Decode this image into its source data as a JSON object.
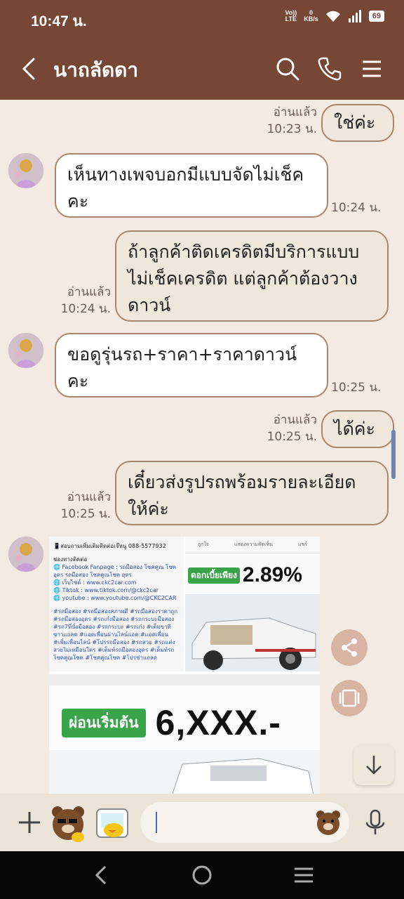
{
  "status": {
    "time": "10:47 น.",
    "net_top": "Vo))",
    "net_bottom": "LTE",
    "speed_top": "0",
    "speed_bottom": "KB/s",
    "battery": "69"
  },
  "header": {
    "title": "นาถลัดดา"
  },
  "messages": [
    {
      "text": "ใช่ค่ะ",
      "read": "อ่านแล้ว",
      "time": "10:23 น."
    },
    {
      "text": "เห็นทางเพจบอกมีแบบจัดไม่เช็คคะ",
      "time": "10:24 น."
    },
    {
      "text": "ถ้าลูกค้าติดเครดิตมีบริการแบบไม่เช็คเครดิต แต่ลูกค้าต้องวางดาวน์",
      "read": "อ่านแล้ว",
      "time": "10:24 น."
    },
    {
      "text": "ขอดูรุ่นรถ+ราคา+ราคาดาวน์คะ",
      "time": "10:25 น."
    },
    {
      "text": "ได้ค่ะ",
      "read": "อ่านแล้ว",
      "time": "10:25 น."
    },
    {
      "text": "เดี๋ยวส่งรูปรถพร้อมรายละเอียดให้ค่ะ",
      "read": "อ่านแล้ว",
      "time": "10:25 น."
    }
  ],
  "image_post": {
    "phone_line": "📱สอบถามเพิ่มเติมติดต่อเจ๊หนู 088-5577932",
    "channels_title": "ช่องทางติดต่อ",
    "facebook": "🌐 Facebook Fanpage : รถมือสอง โชคคูณ โชค อุดร รถมือสอง โชคคูณโชค อุดร",
    "website": "🌐 เว็บไซต์ : www.ckc2car.com",
    "tiktok": "🌐 Tiktok : www.tiktok.com/@ckc2car",
    "youtube": "🌐 youtube : www.youtube.com/@CKC2CAR",
    "hashtags": "#รถมือสอง #รถมือสองสภาพดี #รถมือสองราคาถูก #รถมือสองอุดร #รถเก๋งมือสอง #รถกระบะมือสอง #รถ7ที่นั่งมือสอง #รถกระบะ #รถเก๋ง #เต็มขาดิซาวแถลด #แอดเพื่อนผ่านไลน์แอด #แอดเพื่อน #เพิ่มเพื่อนไลน์ #โปรรถมือสอง #รถสวย #รถแต่งสวยไม่เหมือนใคร #เต็มท์รถมือสองอุดร #เต็มท์รถโชคคูณโชค #โชคคูณโชค #โปรซ่าแถลด",
    "fb_like": "ถูกใจ",
    "fb_comment": "แสดงความคิดเห็น",
    "fb_share": "แชร์",
    "interest_label": "ดอกเบี้ยเพียง",
    "interest_value": "2.89%",
    "installment_label": "ผ่อนเริ่มต้น",
    "installment_value": "6,XXX.-"
  }
}
